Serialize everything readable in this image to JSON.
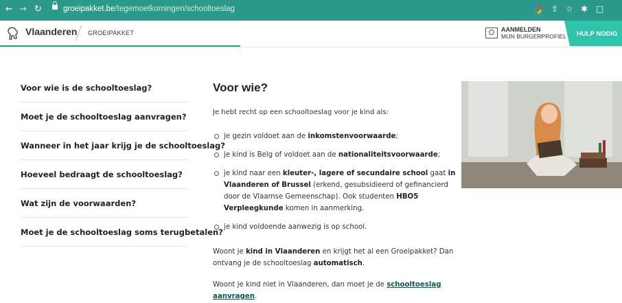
{
  "browser": {
    "url_host": "groeipakket.be",
    "url_path": "/tegemoetkomingen/schooltoeslag"
  },
  "header": {
    "brand": "Vlaanderen",
    "site_name": "GROEIPAKKET",
    "login_line1": "AANMELDEN",
    "login_line2": "MIJN BURGERPROFIEL",
    "help_label": "HULP NODIG"
  },
  "sidebar": {
    "items": [
      {
        "label": "Voor wie is de schooltoeslag?"
      },
      {
        "label": "Moet je de schooltoeslag aanvragen?"
      },
      {
        "label": "Wanneer in het jaar krijg je de schooltoeslag?"
      },
      {
        "label": "Hoeveel bedraagt de schooltoeslag?"
      },
      {
        "label": "Wat zijn de voorwaarden?"
      },
      {
        "label": "Moet je de schooltoeslag soms terugbetalen?"
      }
    ]
  },
  "main": {
    "title": "Voor wie?",
    "intro": "Je hebt recht op een schooltoeslag voor je kind als:",
    "bullets": {
      "b1_pre": "je gezin voldoet aan de ",
      "b1_bold": "inkomstenvoorwaarde",
      "b1_post": ";",
      "b2_pre": "je kind is Belg of voldoet aan de ",
      "b2_bold": "nationaliteitsvoorwaarde",
      "b2_post": ";",
      "b3_pre": "je kind naar een ",
      "b3_bold1": "kleuter-, lagere of secundaire school",
      "b3_mid1": " gaat ",
      "b3_bold2": "in Vlaanderen of Brussel",
      "b3_mid2": " (erkend, gesubsidieerd of gefinancierd door de Vlaamse Gemeenschap). Ook studenten ",
      "b3_bold3": "HBO5 Verpleegkunde",
      "b3_post": " komen in aanmerking.",
      "b4": "je kind voldoende aanwezig is op school."
    },
    "para1": {
      "pre": "Woont je ",
      "bold1": "kind in Vlaanderen",
      "mid": " en krijgt het al een Groeipakket? Dan ontvang je de schooltoeslag ",
      "bold2": "automatisch",
      "post": "."
    },
    "para2": {
      "pre": "Woont je kind niet in Vlaanderen, dan moet je de ",
      "link": "schooltoeslag aanvragen",
      "post": "."
    }
  }
}
